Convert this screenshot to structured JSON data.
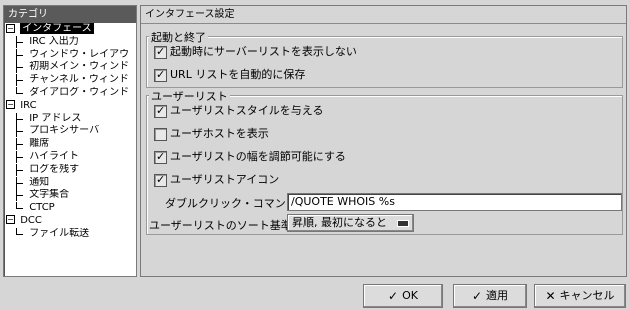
{
  "left": {
    "header": "カテゴリ",
    "tree": [
      {
        "label": "インタフェース",
        "expander": "⊟",
        "selected": true
      },
      {
        "label": "IRC 入出力"
      },
      {
        "label": "ウィンドウ・レイアウ"
      },
      {
        "label": "初期メイン・ウィンド"
      },
      {
        "label": "チャンネル・ウィンド"
      },
      {
        "label": "ダイアログ・ウィンド"
      },
      {
        "label": "IRC",
        "expander": "⊟"
      },
      {
        "label": "IP アドレス"
      },
      {
        "label": "プロキシサーバ"
      },
      {
        "label": "離席"
      },
      {
        "label": "ハイライト"
      },
      {
        "label": "ログを残す"
      },
      {
        "label": "通知"
      },
      {
        "label": "文字集合"
      },
      {
        "label": "CTCP"
      },
      {
        "label": "DCC",
        "expander": "⊟"
      },
      {
        "label": "ファイル転送"
      }
    ]
  },
  "right": {
    "header": "インタフェース設定",
    "group1": {
      "title": "起動と終了",
      "items": [
        {
          "label": "起動時にサーバーリストを表示しない",
          "checked": true
        },
        {
          "label": "URL リストを自動的に保存",
          "checked": true
        }
      ]
    },
    "group2": {
      "title": "ユーザーリスト",
      "items": [
        {
          "label": "ユーザリストスタイルを与える",
          "checked": true
        },
        {
          "label": "ユーザホストを表示",
          "checked": false
        },
        {
          "label": "ユーザリストの幅を調節可能にする",
          "checked": true
        },
        {
          "label": "ユーザリストアイコン",
          "checked": true
        }
      ],
      "doubleclick_label": "ダブルクリック・コマンド:",
      "doubleclick_value": "/QUOTE WHOIS %s",
      "sort_label": "ユーザーリストのソート基準:",
      "sort_value": "昇順, 最初になると"
    }
  },
  "buttons": {
    "ok": "OK",
    "apply": "適用",
    "cancel": "キャンセル"
  }
}
